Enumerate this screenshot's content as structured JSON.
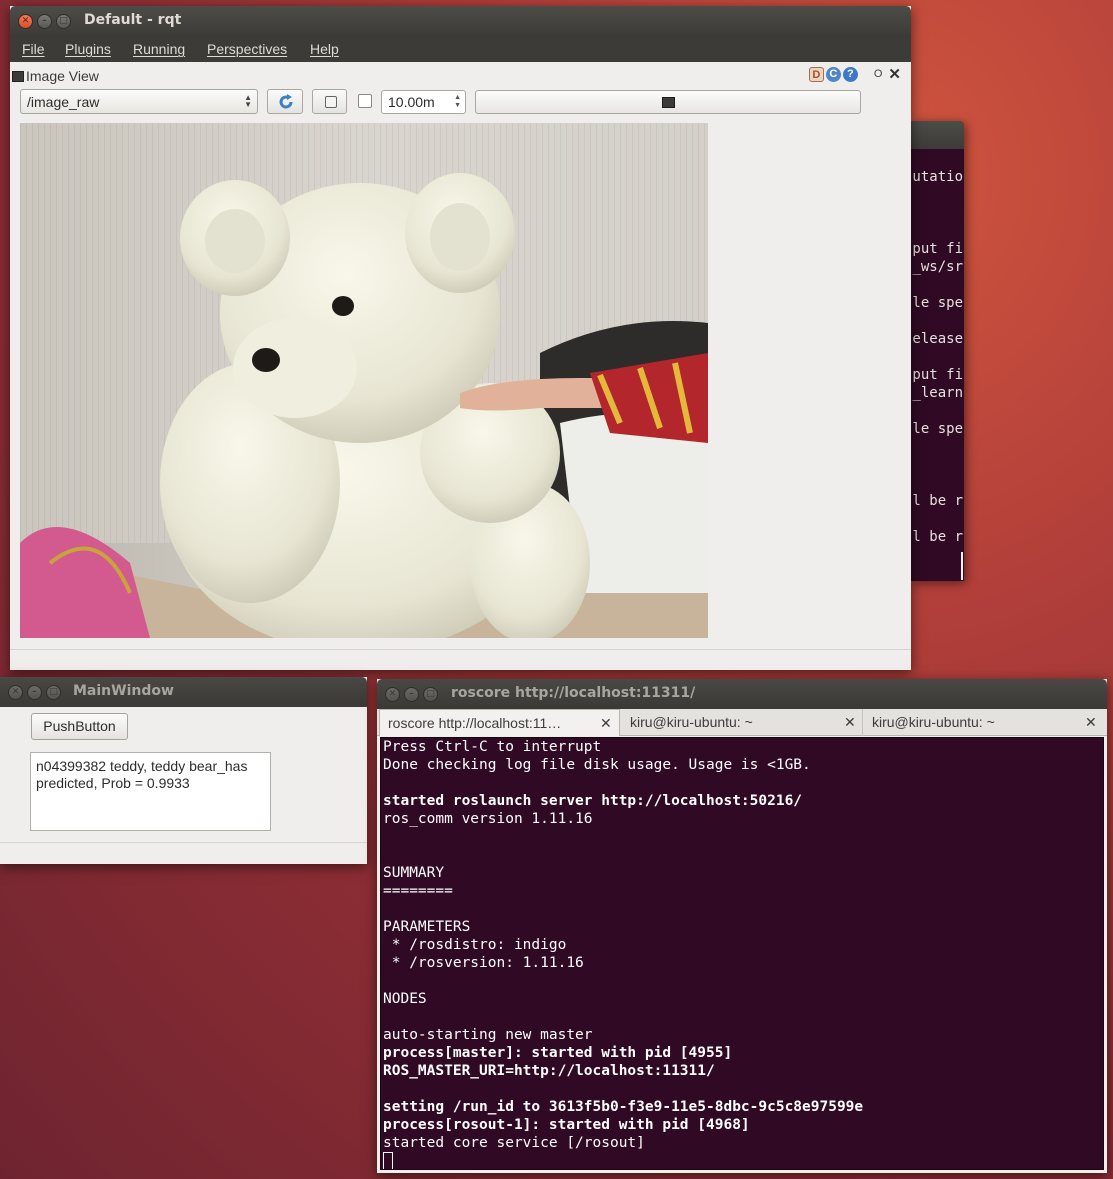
{
  "rqt": {
    "title": "Default - rqt",
    "menu": [
      "File",
      "Plugins",
      "Running",
      "Perspectives",
      "Help"
    ],
    "plugin": {
      "title": "Image View",
      "topic": "/image_raw",
      "refresh_icon": "refresh-icon",
      "save_icon": "save-icon",
      "checkbox_checked": false,
      "spin_value": "10.00m",
      "helper_icons": [
        "D",
        "C",
        "?"
      ],
      "min_label": "O",
      "close_label": "✕"
    },
    "image": {
      "description_icon": "camera-image-teddy-bear"
    }
  },
  "background_terminal": {
    "lines": [
      {
        "text": "utatio",
        "y": 0
      },
      {
        "text": "put fi",
        "y": 1
      },
      {
        "text": "_ws/sr",
        "y": 2
      },
      {
        "text": "le spe",
        "y": 3
      },
      {
        "text": "elease",
        "y": 4
      },
      {
        "text": "put fi",
        "y": 5
      },
      {
        "text": "_learn",
        "y": 6
      },
      {
        "text": "le spe",
        "y": 7
      },
      {
        "text": "l be r",
        "y": 8
      },
      {
        "text": "l be r",
        "y": 9
      }
    ]
  },
  "mainwindow": {
    "title": "MainWindow",
    "button_label": "PushButton",
    "output_line1": "n04399382 teddy, teddy bear_has",
    "output_line2": "predicted, Prob = 0.9933"
  },
  "roscore": {
    "title": "roscore http://localhost:11311/",
    "tabs": [
      {
        "label": "roscore http://localhost:11…",
        "close": "✕",
        "active": true
      },
      {
        "label": "kiru@kiru-ubuntu: ~",
        "close": "✕",
        "active": false
      },
      {
        "label": "kiru@kiru-ubuntu: ~",
        "close": "✕",
        "active": false
      }
    ],
    "lines": [
      {
        "text": "Press Ctrl-C to interrupt",
        "bold": false
      },
      {
        "text": "Done checking log file disk usage. Usage is <1GB.",
        "bold": false
      },
      {
        "text": "",
        "bold": false
      },
      {
        "text": "started roslaunch server http://localhost:50216/",
        "bold": true
      },
      {
        "text": "ros_comm version 1.11.16",
        "bold": false
      },
      {
        "text": "",
        "bold": false
      },
      {
        "text": "",
        "bold": false
      },
      {
        "text": "SUMMARY",
        "bold": false
      },
      {
        "text": "========",
        "bold": false
      },
      {
        "text": "",
        "bold": false
      },
      {
        "text": "PARAMETERS",
        "bold": false
      },
      {
        "text": " * /rosdistro: indigo",
        "bold": false
      },
      {
        "text": " * /rosversion: 1.11.16",
        "bold": false
      },
      {
        "text": "",
        "bold": false
      },
      {
        "text": "NODES",
        "bold": false
      },
      {
        "text": "",
        "bold": false
      },
      {
        "text": "auto-starting new master",
        "bold": false
      },
      {
        "text": "process[master]: started with pid [4955]",
        "bold": true
      },
      {
        "text": "ROS_MASTER_URI=http://localhost:11311/",
        "bold": true
      },
      {
        "text": "",
        "bold": false
      },
      {
        "text": "setting /run_id to 3613f5b0-f3e9-11e5-8dbc-9c5c8e97599e",
        "bold": true
      },
      {
        "text": "process[rosout-1]: started with pid [4968]",
        "bold": true
      },
      {
        "text": "started core service [/rosout]",
        "bold": false
      }
    ]
  }
}
